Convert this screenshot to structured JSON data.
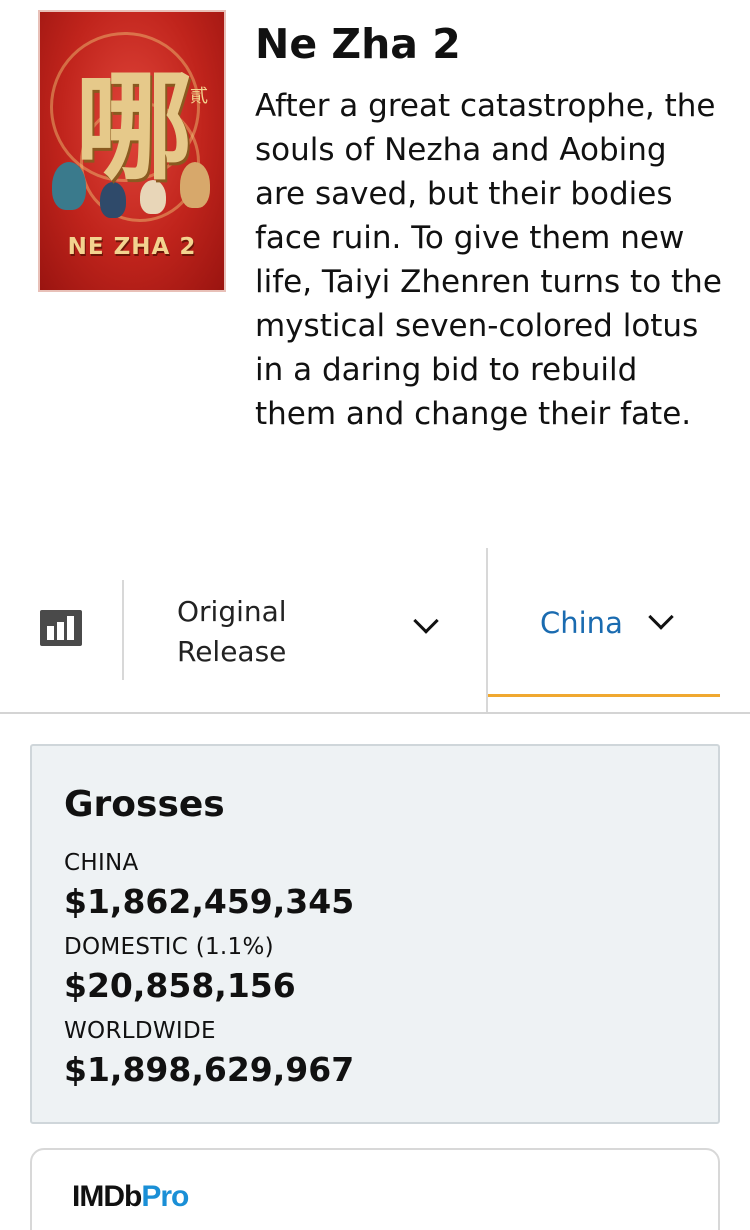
{
  "movie": {
    "title": "Ne Zha 2",
    "poster_title": "NE ZHA 2",
    "poster_glyph": "哪",
    "poster_small_glyph": "貳",
    "synopsis": "After a great catastrophe, the souls of Nezha and Aobing are saved, but their bodies face ruin. To give them new life, Taiyi Zhenren turns to the mystical seven-colored lotus in a daring bid to rebuild them and change their fate."
  },
  "filters": {
    "chart_icon": "bar-chart-icon",
    "release_label": "Original Release",
    "release_chevron": "chevron-down-icon",
    "territory_label": "China",
    "territory_chevron": "chevron-down-icon",
    "accent_color": "#f0a830",
    "link_color": "#1a6bb0"
  },
  "grosses": {
    "heading": "Grosses",
    "rows": [
      {
        "label": "CHINA",
        "value": "$1,862,459,345"
      },
      {
        "label": "DOMESTIC (1.1%)",
        "value": "$20,858,156"
      },
      {
        "label": "WORLDWIDE",
        "value": "$1,898,629,967"
      }
    ]
  },
  "imdbpro": {
    "logo_imdb": "IMDb",
    "logo_pro": "Pro"
  }
}
